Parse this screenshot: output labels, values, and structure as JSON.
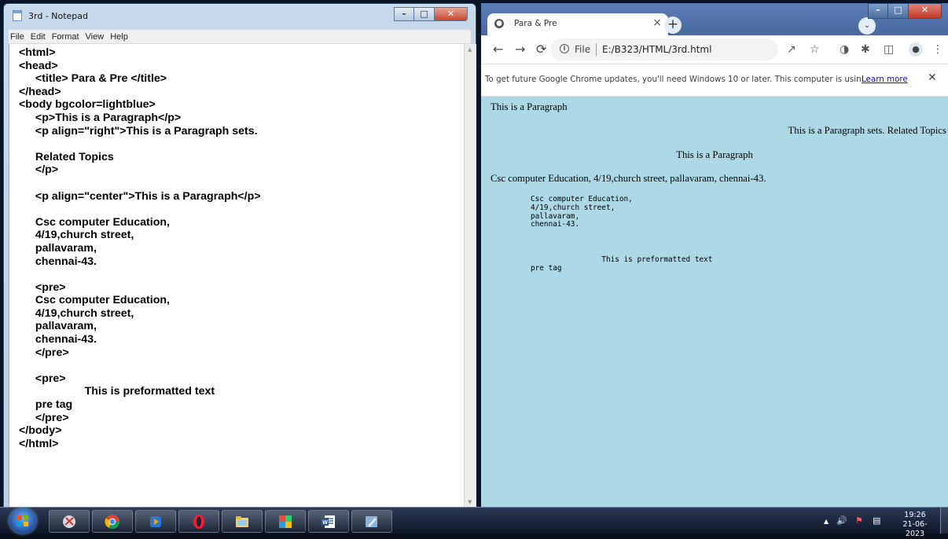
{
  "notepad": {
    "title": "3rd - Notepad",
    "menu": [
      "File",
      "Edit",
      "Format",
      "View",
      "Help"
    ],
    "content": "<html>\n<head>\n\t<title> Para & Pre </title>\n</head>\n<body bgcolor=lightblue>\n\t<p>This is a Paragraph</p>\n\t<p align=\"right\">This is a Paragraph sets.\n\n\tRelated Topics\n\t</p>\n\n\t<p align=\"center\">This is a Paragraph</p>\n\n\tCsc computer Education,\n\t4/19,church street,\n\tpallavaram,\n\tchennai-43.\n\n\t<pre>\n\tCsc computer Education,\n\t4/19,church street,\n\tpallavaram,\n\tchennai-43.\n\t</pre>\n\n\t<pre>\n\t\t\t\tThis is preformatted text\n\tpre tag\n\t</pre>\n</body>\n</html>"
  },
  "chrome": {
    "tab_title": "Para & Pre",
    "address_scheme": "File",
    "address_url": "E:/B323/HTML/3rd.html",
    "infobar_text": "To get future Google Chrome updates, you'll need Windows 10 or later. This computer is usin...",
    "infobar_link": "Learn more",
    "page": {
      "bg": "#add8e6",
      "p1": "This is a Paragraph",
      "p2": "This is a Paragraph sets. Related Topics",
      "p3": "This is a Paragraph",
      "p4": "Csc computer Education, 4/19,church street, pallavaram, chennai-43.",
      "pre1": "Csc computer Education,\n4/19,church street,\npallavaram,\nchennai-43.",
      "pre2": "                This is preformatted text\npre tag"
    }
  },
  "taskbar": {
    "apps": [
      "ie-icon",
      "snipping-tool-icon",
      "chrome-icon",
      "media-player-icon",
      "opera-icon",
      "file-explorer-icon",
      "color-app-icon",
      "word-icon",
      "paint-icon"
    ],
    "time": "19:26",
    "date": "21-06-2023"
  }
}
